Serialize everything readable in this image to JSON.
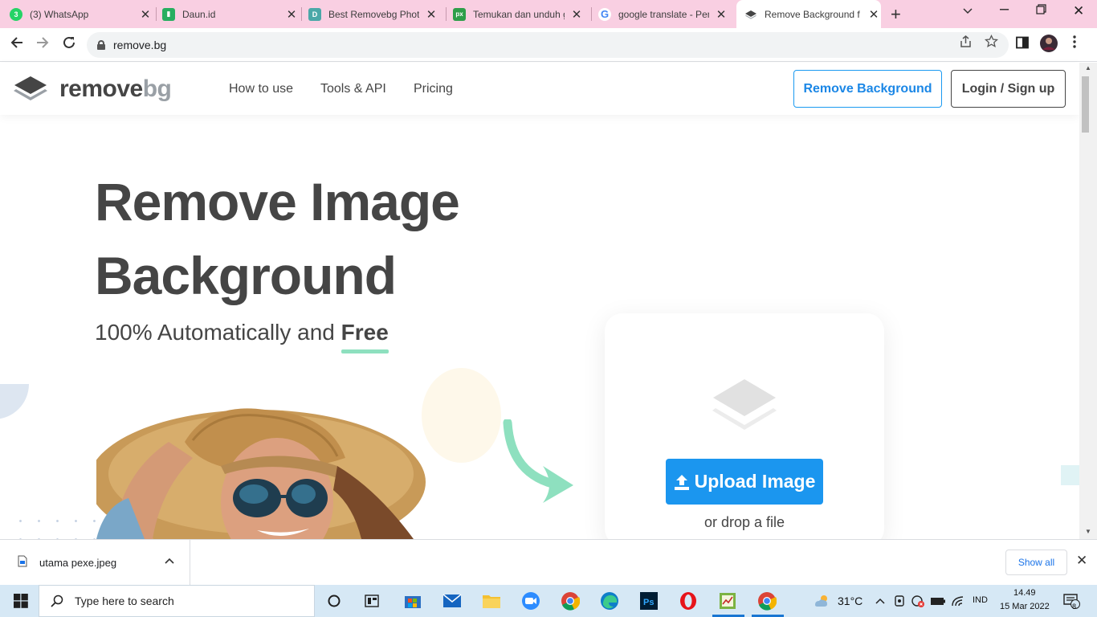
{
  "browser": {
    "tabs": [
      {
        "title": "(3) WhatsApp",
        "favicon": "whatsapp-icon",
        "color": "#25d366",
        "badge": "3",
        "active": false
      },
      {
        "title": "Daun.id",
        "favicon": "daun-icon",
        "color": "#27ae60",
        "badge": "",
        "active": false
      },
      {
        "title": "Best Removebg Photo",
        "favicon": "d-icon",
        "color": "#4aa8a8",
        "badge": "D",
        "active": false
      },
      {
        "title": "Temukan dan unduh g",
        "favicon": "px-icon",
        "color": "#2e9e4a",
        "badge": "px",
        "active": false
      },
      {
        "title": "google translate - Pen",
        "favicon": "google-icon",
        "color": "#4285f4",
        "badge": "G",
        "active": false
      },
      {
        "title": "Remove Background f",
        "favicon": "removebg-icon",
        "color": "#454545",
        "badge": "",
        "active": true
      }
    ],
    "url": "remove.bg"
  },
  "site": {
    "logo": {
      "part1": "remove",
      "part2": "bg"
    },
    "nav": [
      "How to use",
      "Tools & API",
      "Pricing"
    ],
    "cta_remove": "Remove Background",
    "cta_login": "Login / Sign up",
    "hero_title_line1": "Remove Image",
    "hero_title_line2": "Background",
    "hero_sub": "100% Automatically and ",
    "hero_sub_bold": "Free",
    "upload_label": "Upload Image",
    "drop_text": "or drop a file",
    "colors": {
      "accent": "#1b96ef",
      "text": "#454545",
      "underline": "#8ee0bf"
    }
  },
  "downloads": {
    "file_name": "utama pexe.jpeg",
    "show_all": "Show all"
  },
  "taskbar": {
    "search_placeholder": "Type here to search",
    "weather": "31°C",
    "language": "IND",
    "time": "14.49",
    "date": "15 Mar 2022",
    "notifications": "8"
  }
}
